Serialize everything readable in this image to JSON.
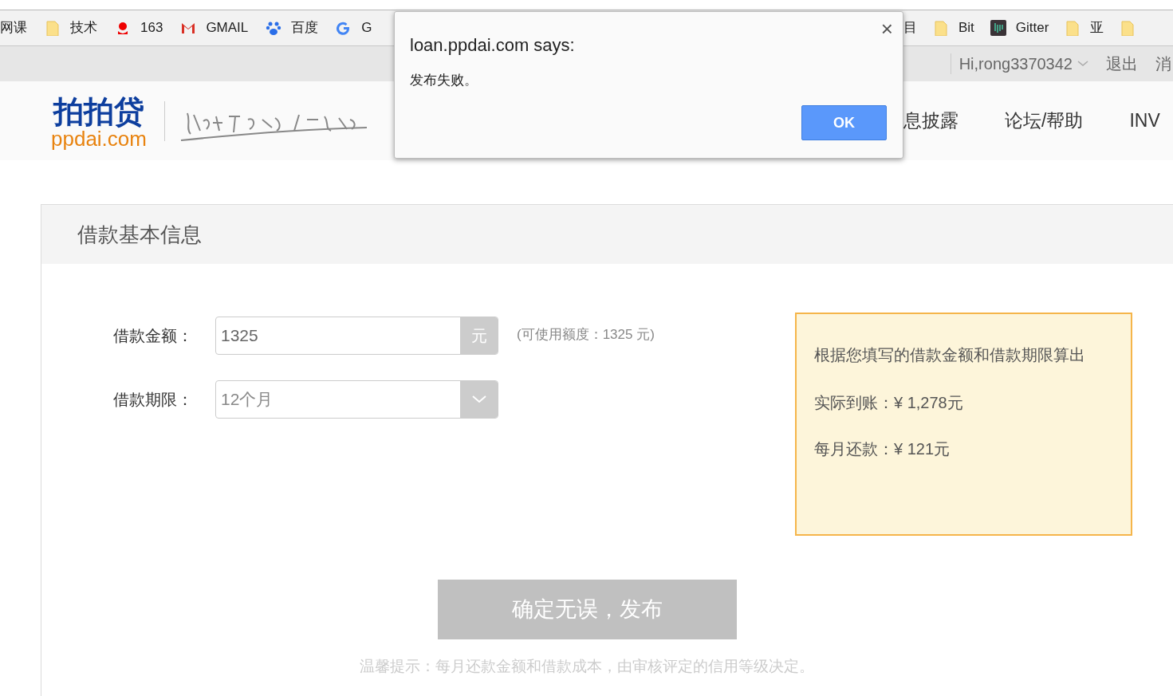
{
  "bookmarks_left": [
    {
      "kind": "none",
      "label": "网课"
    },
    {
      "kind": "folder",
      "label": "技术"
    },
    {
      "kind": "netease",
      "label": "163"
    },
    {
      "kind": "gmail",
      "label": "GMAIL"
    },
    {
      "kind": "baidu",
      "label": "百度"
    },
    {
      "kind": "google",
      "label": "G"
    }
  ],
  "bookmarks_right": [
    {
      "kind": "none",
      "label": "目"
    },
    {
      "kind": "folder",
      "label": "Bit"
    },
    {
      "kind": "gitter",
      "label": "Gitter"
    },
    {
      "kind": "folder",
      "label": "亚"
    },
    {
      "kind": "folder"
    }
  ],
  "top_nav": {
    "user": "Hi,rong3370342",
    "links": [
      "退出",
      "消"
    ]
  },
  "header": {
    "logo": {
      "cn": "拍拍贷",
      "en": "ppdai.com"
    },
    "nav": [
      "息披露",
      "论坛/帮助",
      "INV"
    ]
  },
  "panel": {
    "title": "借款基本信息",
    "amount": {
      "label": "借款金额：",
      "value": "1325",
      "unit": "元",
      "note": "(可使用额度：1325 元)"
    },
    "term": {
      "label": "借款期限：",
      "value": "12个月"
    },
    "summary": {
      "title": "根据您填写的借款金额和借款期限算出",
      "lines": [
        "实际到账：¥ 1,278元",
        "每月还款：¥ 121元"
      ]
    },
    "submit": {
      "label": "确定无误，发布",
      "disabled": true
    },
    "hint": "温馨提示：每月还款金额和借款成本，由审核评定的信用等级决定。"
  },
  "dialog": {
    "title": "loan.ppdai.com says:",
    "message": "发布失败。",
    "ok": "OK",
    "close": "×"
  }
}
